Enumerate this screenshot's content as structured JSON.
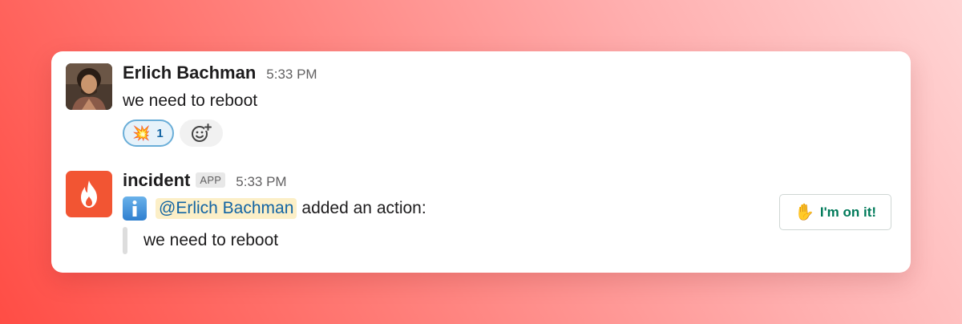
{
  "messages": [
    {
      "sender": "Erlich Bachman",
      "time": "5:33 PM",
      "text": "we need to reboot",
      "reactions": [
        {
          "emoji": "💥",
          "count": "1"
        }
      ]
    },
    {
      "sender": "incident",
      "badge": "APP",
      "time": "5:33 PM",
      "mention": "@Erlich Bachman",
      "action_text": "added an action:",
      "quote": "we need to reboot",
      "button_emoji": "✋",
      "button_label": "I'm on it!"
    }
  ],
  "icons": {
    "message_1_avatar": "user-avatar-photo",
    "message_2_avatar": "flame-icon",
    "add_reaction": "add-emoji-icon",
    "info": "information-icon"
  },
  "colors": {
    "incident_brand": "#f25533",
    "link": "#1264a3",
    "button_text": "#007a5a",
    "reaction_border": "#6aaed8"
  }
}
